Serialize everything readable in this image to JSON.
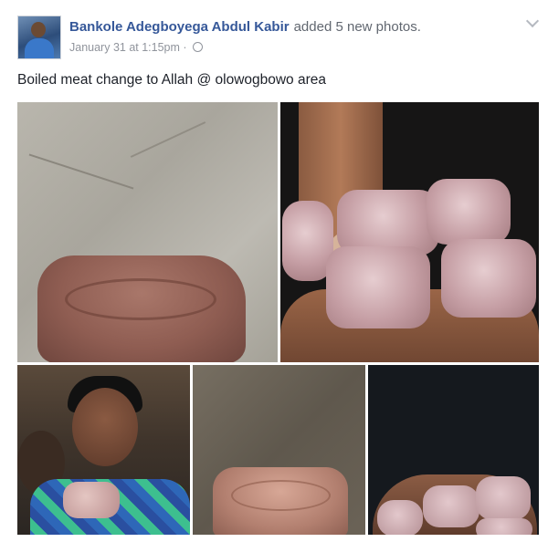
{
  "post": {
    "author_name": "Bankole Adegboyega Abdul Kabir",
    "action_text": "added 5 new photos.",
    "timestamp": "January 31 at 1:15pm",
    "separator": "·",
    "privacy_icon": "globe-icon",
    "options_icon": "chevron-down-icon",
    "caption": "Boiled meat change to Allah @ olowogbowo area",
    "photos": [
      {
        "description_icon": "photo"
      },
      {
        "description_icon": "photo"
      },
      {
        "description_icon": "photo"
      },
      {
        "description_icon": "photo"
      },
      {
        "description_icon": "photo"
      }
    ]
  },
  "colors": {
    "author_link": "#365899",
    "meta_text": "#90949c",
    "body_text": "#1d2129"
  }
}
